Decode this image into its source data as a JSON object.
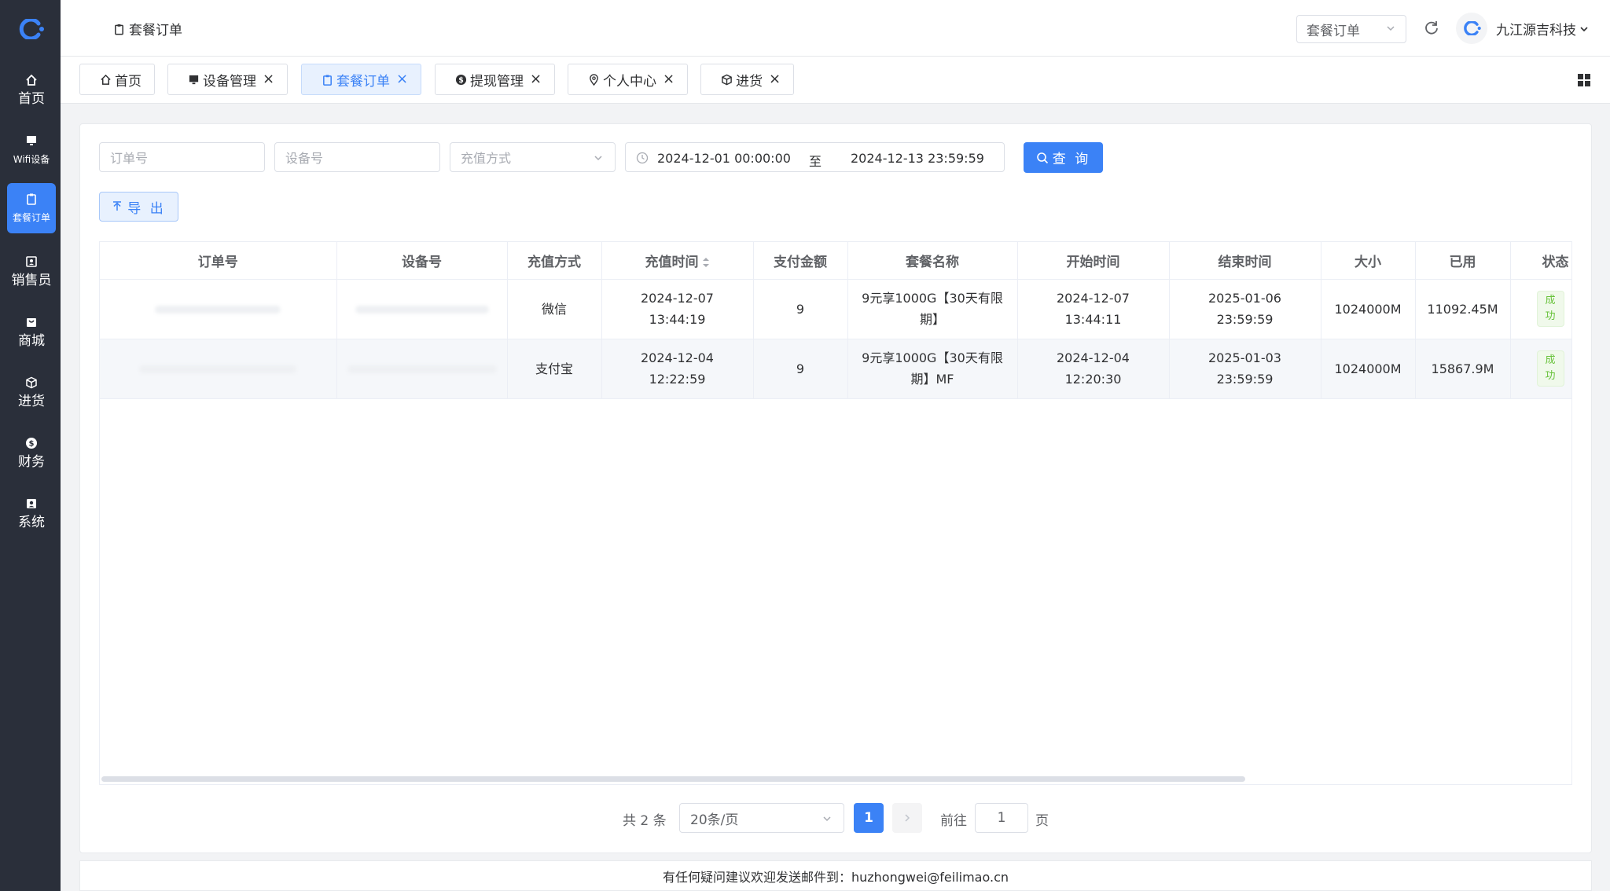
{
  "sidebar": {
    "items": [
      {
        "label": "首页",
        "icon": "home-icon"
      },
      {
        "label": "Wifi设备",
        "icon": "monitor-icon"
      },
      {
        "label": "套餐订单",
        "icon": "clipboard-icon",
        "active": true
      },
      {
        "label": "销售员",
        "icon": "id-card-icon"
      },
      {
        "label": "商城",
        "icon": "shop-icon"
      },
      {
        "label": "进货",
        "icon": "box-icon"
      },
      {
        "label": "财务",
        "icon": "coin-icon"
      },
      {
        "label": "系统",
        "icon": "user-card-icon"
      }
    ],
    "accent": "#3b82f6",
    "background": "#2a2f3a"
  },
  "header": {
    "breadcrumb": "套餐订单",
    "search_select": "套餐订单",
    "company": "九江源吉科技"
  },
  "tabs": [
    {
      "label": "首页",
      "icon": "home-icon",
      "closable": false
    },
    {
      "label": "设备管理",
      "icon": "monitor-icon",
      "closable": true
    },
    {
      "label": "套餐订单",
      "icon": "clipboard-icon",
      "closable": true,
      "active": true
    },
    {
      "label": "提现管理",
      "icon": "coin-icon",
      "closable": true
    },
    {
      "label": "个人中心",
      "icon": "location-icon",
      "closable": true
    },
    {
      "label": "进货",
      "icon": "box-icon",
      "closable": true
    }
  ],
  "filters": {
    "order_placeholder": "订单号",
    "device_placeholder": "设备号",
    "method_placeholder": "充值方式",
    "date_start": "2024-12-01 00:00:00",
    "date_to": "至",
    "date_end": "2024-12-13 23:59:59",
    "query_label": "查 询",
    "export_label": "导 出"
  },
  "table": {
    "columns": [
      "订单号",
      "设备号",
      "充值方式",
      "充值时间",
      "支付金额",
      "套餐名称",
      "开始时间",
      "结束时间",
      "大小",
      "已用",
      "状态"
    ],
    "rows": [
      {
        "order": "",
        "device": "",
        "method": "微信",
        "time": "2024-12-07 13:44:19",
        "amount": "9",
        "package": "9元享1000G【30天有限期】",
        "start": "2024-12-07 13:44:11",
        "end": "2025-01-06 23:59:59",
        "size": "1024000M",
        "used": "11092.45M",
        "status": "成功"
      },
      {
        "order": "",
        "device": "",
        "method": "支付宝",
        "time": "2024-12-04 12:22:59",
        "amount": "9",
        "package": "9元享1000G【30天有限期】MF",
        "start": "2024-12-04 12:20:30",
        "end": "2025-01-03 23:59:59",
        "size": "1024000M",
        "used": "15867.9M",
        "status": "成功"
      }
    ]
  },
  "pagination": {
    "total": "共 2 条",
    "page_size": "20条/页",
    "current": "1",
    "goto_label": "前往",
    "goto_value": "1",
    "page_suffix": "页"
  },
  "footer": {
    "text": "有任何疑问建议欢迎发送邮件到：huzhongwei@feilimao.cn"
  }
}
